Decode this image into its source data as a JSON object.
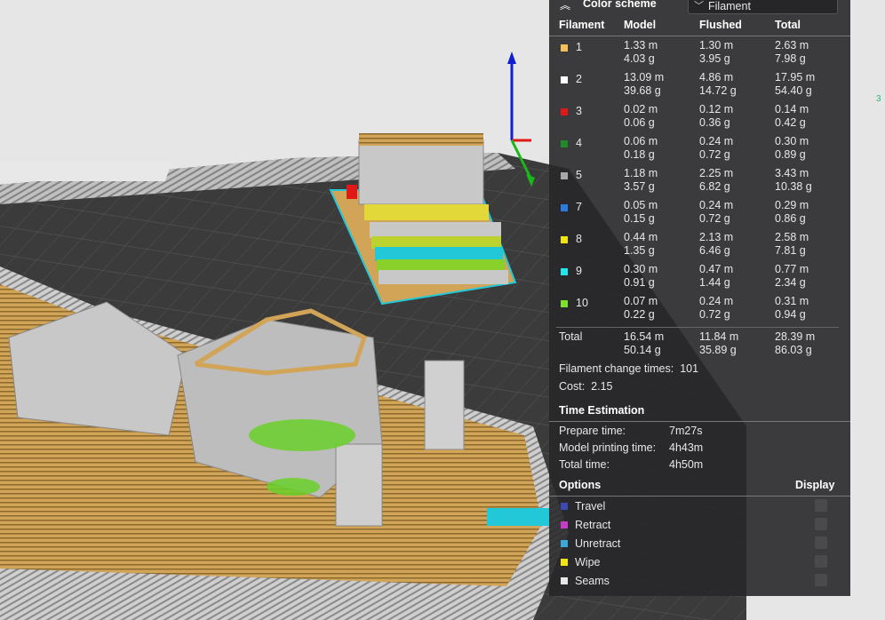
{
  "header": {
    "title": "Color scheme",
    "scheme_value": "Filament"
  },
  "table": {
    "columns": [
      "Filament",
      "Model",
      "Flushed",
      "Total"
    ],
    "rows": [
      {
        "id": "1",
        "color": "#f5bf5a",
        "model": [
          "1.33 m",
          "4.03 g"
        ],
        "flushed": [
          "1.30 m",
          "3.95 g"
        ],
        "total": [
          "2.63 m",
          "7.98 g"
        ]
      },
      {
        "id": "2",
        "color": "#ffffff",
        "model": [
          "13.09 m",
          "39.68 g"
        ],
        "flushed": [
          "4.86 m",
          "14.72 g"
        ],
        "total": [
          "17.95 m",
          "54.40 g"
        ]
      },
      {
        "id": "3",
        "color": "#e01818",
        "model": [
          "0.02 m",
          "0.06 g"
        ],
        "flushed": [
          "0.12 m",
          "0.36 g"
        ],
        "total": [
          "0.14 m",
          "0.42 g"
        ]
      },
      {
        "id": "4",
        "color": "#1f8a2a",
        "model": [
          "0.06 m",
          "0.18 g"
        ],
        "flushed": [
          "0.24 m",
          "0.72 g"
        ],
        "total": [
          "0.30 m",
          "0.89 g"
        ]
      },
      {
        "id": "5",
        "color": "#a8a8a8",
        "model": [
          "1.18 m",
          "3.57 g"
        ],
        "flushed": [
          "2.25 m",
          "6.82 g"
        ],
        "total": [
          "3.43 m",
          "10.38 g"
        ]
      },
      {
        "id": "7",
        "color": "#2a7ae0",
        "model": [
          "0.05 m",
          "0.15 g"
        ],
        "flushed": [
          "0.24 m",
          "0.72 g"
        ],
        "total": [
          "0.29 m",
          "0.86 g"
        ]
      },
      {
        "id": "8",
        "color": "#f2e40e",
        "model": [
          "0.44 m",
          "1.35 g"
        ],
        "flushed": [
          "2.13 m",
          "6.46 g"
        ],
        "total": [
          "2.58 m",
          "7.81 g"
        ]
      },
      {
        "id": "9",
        "color": "#22e6ee",
        "model": [
          "0.30 m",
          "0.91 g"
        ],
        "flushed": [
          "0.47 m",
          "1.44 g"
        ],
        "total": [
          "0.77 m",
          "2.34 g"
        ]
      },
      {
        "id": "10",
        "color": "#7ee02a",
        "model": [
          "0.07 m",
          "0.22 g"
        ],
        "flushed": [
          "0.24 m",
          "0.72 g"
        ],
        "total": [
          "0.31 m",
          "0.94 g"
        ]
      }
    ],
    "total": {
      "label": "Total",
      "model": [
        "16.54 m",
        "50.14 g"
      ],
      "flushed": [
        "11.84 m",
        "35.89 g"
      ],
      "total": [
        "28.39 m",
        "86.03 g"
      ]
    }
  },
  "stats": {
    "change_label": "Filament change times:",
    "change_value": "101",
    "cost_label": "Cost:",
    "cost_value": "2.15"
  },
  "time": {
    "title": "Time Estimation",
    "rows": [
      {
        "label": "Prepare time:",
        "value": "7m27s"
      },
      {
        "label": "Model printing time:",
        "value": "4h43m"
      },
      {
        "label": "Total time:",
        "value": "4h50m"
      }
    ]
  },
  "options": {
    "title": "Options",
    "display_label": "Display",
    "items": [
      {
        "label": "Travel",
        "color": "#3d4bb0"
      },
      {
        "label": "Retract",
        "color": "#c83ac8"
      },
      {
        "label": "Unretract",
        "color": "#3aa8d8"
      },
      {
        "label": "Wipe",
        "color": "#f2e40e"
      },
      {
        "label": "Seams",
        "color": "#e8e8e8"
      }
    ]
  },
  "side_marker": "3"
}
